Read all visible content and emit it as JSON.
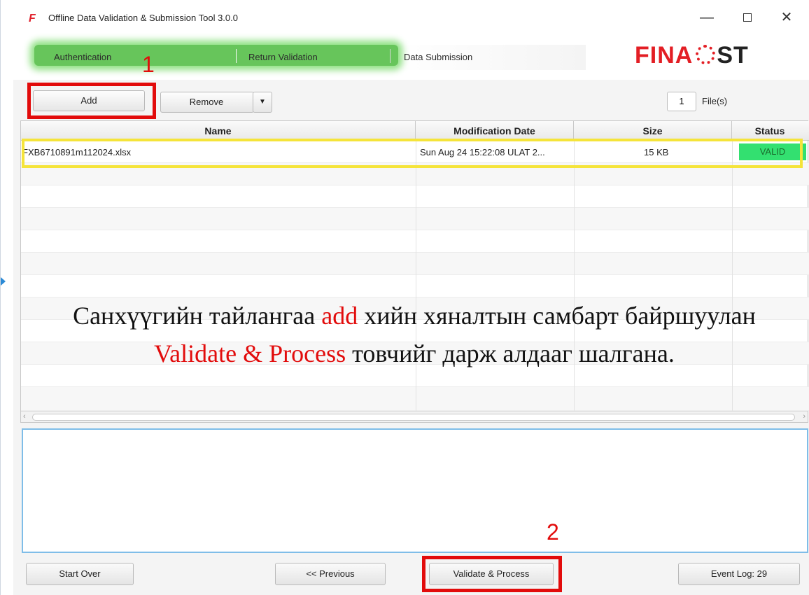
{
  "window": {
    "title": "Offline Data Validation & Submission Tool 3.0.0",
    "logo_glyph": "F",
    "minimize_glyph": "—",
    "close_glyph": "✕"
  },
  "steps": {
    "items": [
      {
        "label": "Authentication",
        "state": "done"
      },
      {
        "label": "Return Validation",
        "state": "done"
      },
      {
        "label": "Data Submission",
        "state": "current"
      }
    ],
    "active_color": "#67c55b"
  },
  "brand": {
    "left": "FINA",
    "right": "ST",
    "color": "#e31e24"
  },
  "toolbar": {
    "add_label": "Add",
    "remove_label": "Remove",
    "remove_dropdown_glyph": "▼",
    "file_count": "1",
    "file_count_suffix": "File(s)"
  },
  "table": {
    "columns": [
      "Name",
      "Modification Date",
      "Size",
      "Status"
    ],
    "rows": [
      {
        "name": "FXB6710891m112024.xlsx",
        "modified": "Sun Aug 24 15:22:08 ULAT 2...",
        "size": "15 KB",
        "status": "VALID",
        "status_color": "#33e070"
      }
    ]
  },
  "annotations": {
    "marker_1": "1",
    "marker_2": "2",
    "caption_part1": "Санхүүгийн тайлангаа ",
    "caption_red1": "add",
    "caption_part2": " хийн хяналтын самбарт байршуулан ",
    "caption_red2": "Validate & Process",
    "caption_part3": " товчийг дарж алдааг шалгана.",
    "highlight_color": "#e20b0b",
    "row_highlight_color": "#f5e43a"
  },
  "bottom": {
    "start_over_label": "Start Over",
    "previous_label": "<< Previous",
    "validate_label": "Validate & Process",
    "event_log_label": "Event Log: 29"
  }
}
